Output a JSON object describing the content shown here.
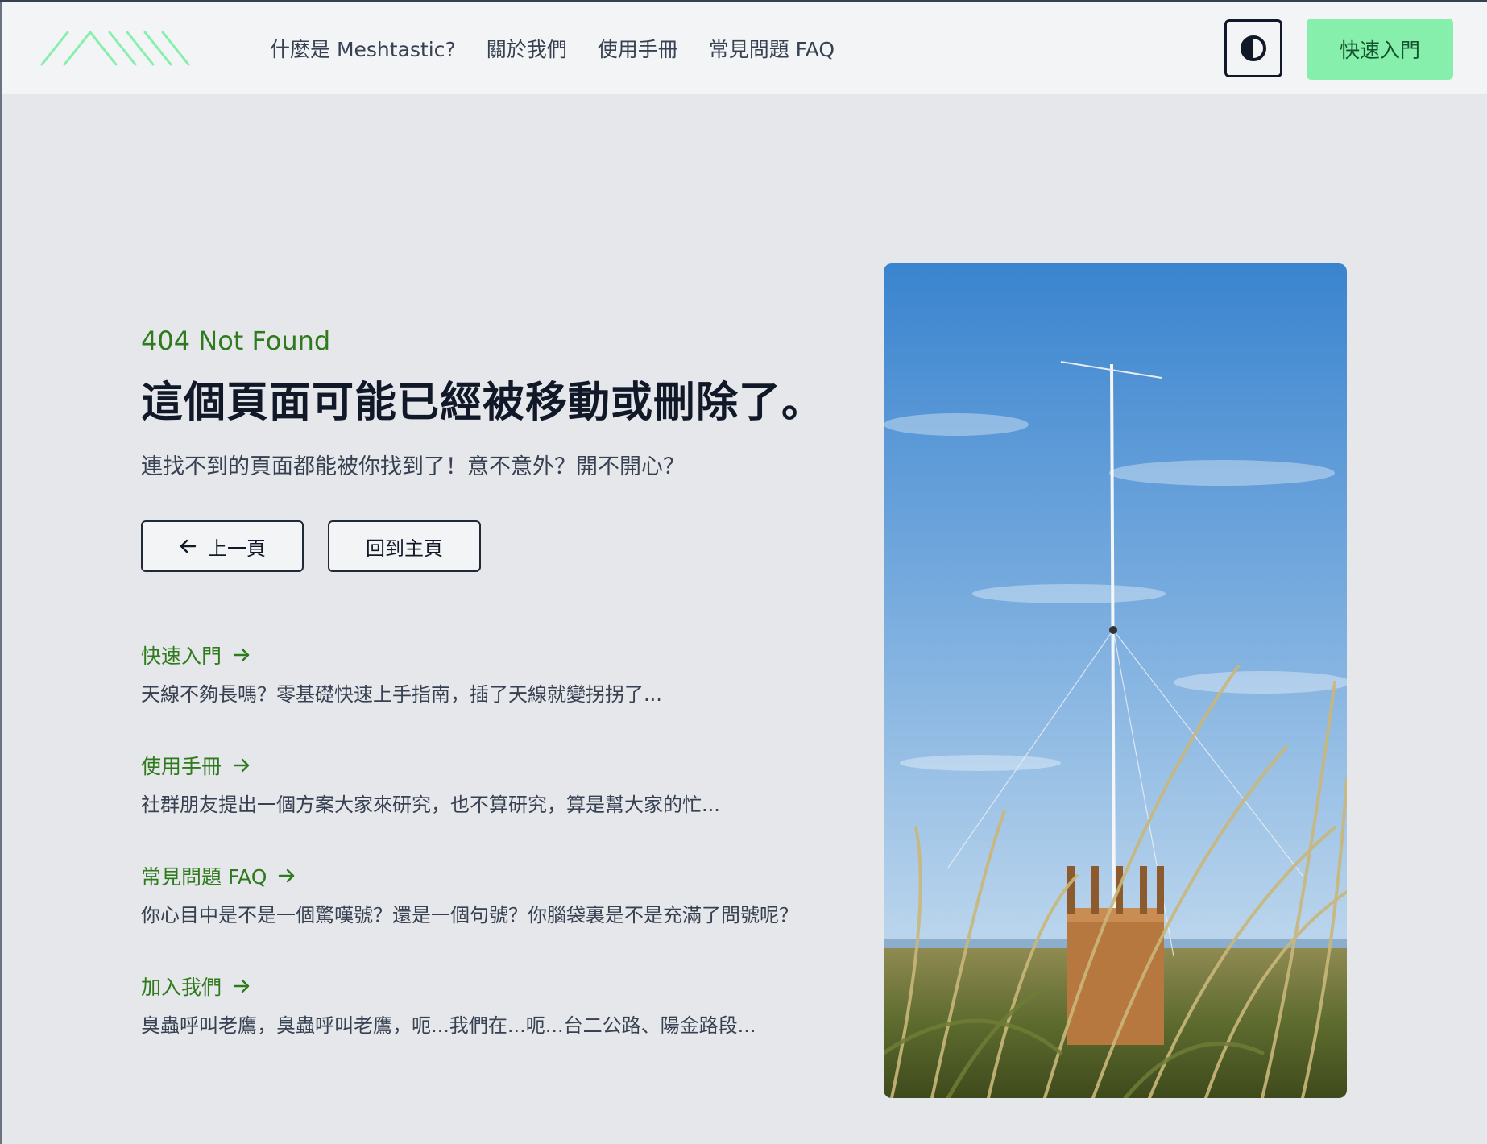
{
  "header": {
    "nav": [
      {
        "label": "什麼是 Meshtastic?"
      },
      {
        "label": "關於我們"
      },
      {
        "label": "使用手冊"
      },
      {
        "label": "常見問題 FAQ"
      }
    ],
    "theme_toggle_icon": "contrast-icon",
    "cta_label": "快速入門",
    "logo_icon": "meshtastic-logo-icon"
  },
  "main": {
    "eyebrow": "404 Not Found",
    "headline": "這個頁面可能已經被移動或刪除了。",
    "subtext": "連找不到的頁面都能被你找到了！意不意外？開不開心？",
    "back_button": "上一頁",
    "home_button": "回到主頁",
    "links": [
      {
        "title": "快速入門",
        "desc": "天線不夠長嗎？零基礎快速上手指南，插了天線就變拐拐了..."
      },
      {
        "title": "使用手冊",
        "desc": "社群朋友提出一個方案大家來研究，也不算研究，算是幫大家的忙..."
      },
      {
        "title": "常見問題 FAQ",
        "desc": "你心目中是不是一個驚嘆號？還是一個句號？你腦袋裏是不是充滿了問號呢？"
      },
      {
        "title": "加入我們",
        "desc": "臭蟲呼叫老鷹，臭蟲呼叫老鷹，呃...我們在...呃...台二公路、陽金路段..."
      }
    ]
  },
  "colors": {
    "accent_green": "#2f7a1c",
    "cta_green": "#86efac",
    "background": "#e5e7eb",
    "header_bg": "#f3f4f6"
  }
}
